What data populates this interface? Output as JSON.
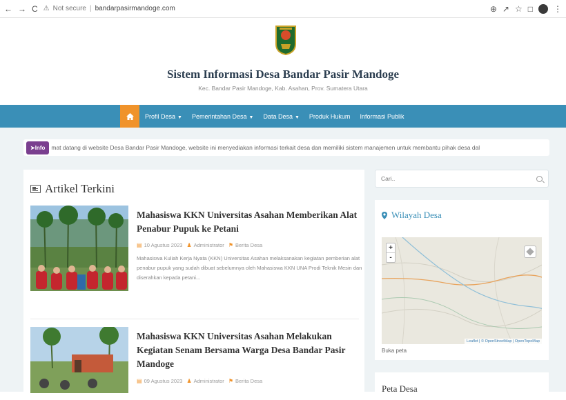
{
  "browser": {
    "nav": [
      "←",
      "→",
      "C"
    ],
    "security": "Not secure",
    "url": "bandarpasirmandoge.com",
    "icons": [
      "key-icon",
      "share-icon",
      "star-icon",
      "extension-icon",
      "profile-icon"
    ]
  },
  "header": {
    "title": "Sistem Informasi Desa Bandar Pasir Mandoge",
    "subtitle": "Kec. Bandar Pasir Mandoge, Kab. Asahan, Prov. Sumatera Utara"
  },
  "menu": {
    "items": [
      {
        "label": "Profil Desa",
        "dropdown": true
      },
      {
        "label": "Pemerintahan Desa",
        "dropdown": true
      },
      {
        "label": "Data Desa",
        "dropdown": true
      },
      {
        "label": "Produk Hukum",
        "dropdown": false
      },
      {
        "label": "Informasi Publik",
        "dropdown": false
      }
    ]
  },
  "ticker": {
    "badge": "Info",
    "text": "mat datang di website Desa Bandar Pasir Mandoge, website ini menyediakan informasi terkait desa dan memiliki sistem manajemen untuk membantu pihak desa dal"
  },
  "articles_section": {
    "title": "Artikel Terkini",
    "items": [
      {
        "title": "Mahasiswa KKN Universitas Asahan Memberikan Alat Penabur Pupuk ke Petani",
        "date": "10 Agustus 2023",
        "author": "Administrator",
        "category": "Berita Desa",
        "excerpt": "Mahasiswa Kuliah Kerja Nyata (KKN) Universitas Asahan melaksanakan kegiatan pemberian alat penabur pupuk yang sudah dibuat sebelumnya oleh Mahasiswa KKN UNA Prodi Teknik Mesin dan diserahkan kepada petani..."
      },
      {
        "title": "Mahasiswa KKN Universitas Asahan Melakukan Kegiatan Senam Bersama Warga Desa Bandar Pasir Mandoge",
        "date": "09 Agustus 2023",
        "author": "Administrator",
        "category": "Berita Desa"
      }
    ]
  },
  "sidebar": {
    "search_placeholder": "Cari..",
    "wilayah": {
      "title": "Wilayah Desa",
      "zoom_in": "+",
      "zoom_out": "-",
      "attribution": "Leaflet | © OpenStreetMap | OpenTopoMap",
      "link": "Buka peta"
    },
    "peta": {
      "title": "Peta Desa"
    }
  },
  "colors": {
    "menu_bg": "#3a8fb7",
    "home_btn": "#f0932b",
    "ticker_badge": "#7a3f8f",
    "page_bg": "#eef3f5"
  }
}
